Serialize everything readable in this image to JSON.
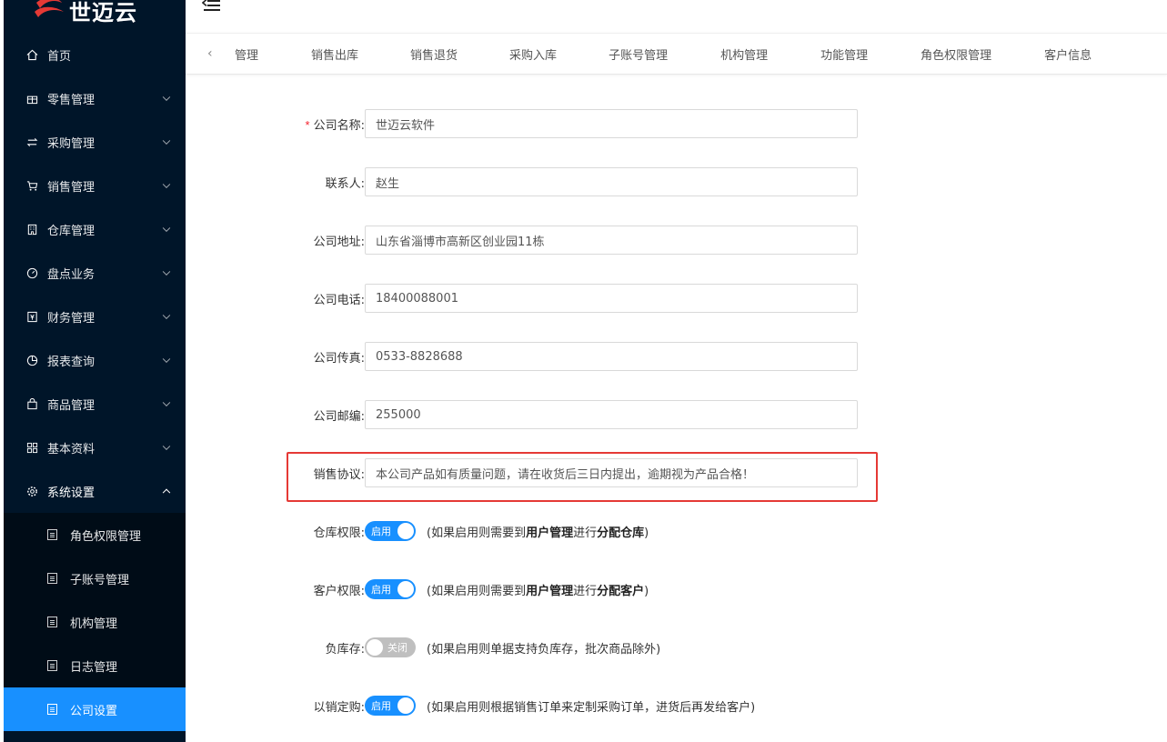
{
  "brand": {
    "name": "世迈云"
  },
  "sidebar": {
    "items": [
      {
        "label": "首页",
        "icon": "home-icon"
      },
      {
        "label": "零售管理",
        "icon": "gift-icon"
      },
      {
        "label": "采购管理",
        "icon": "swap-icon"
      },
      {
        "label": "销售管理",
        "icon": "cart-icon"
      },
      {
        "label": "仓库管理",
        "icon": "building-icon"
      },
      {
        "label": "盘点业务",
        "icon": "dashboard-icon"
      },
      {
        "label": "财务管理",
        "icon": "account-book-icon"
      },
      {
        "label": "报表查询",
        "icon": "pie-chart-icon"
      },
      {
        "label": "商品管理",
        "icon": "shopping-bag-icon"
      },
      {
        "label": "基本资料",
        "icon": "appstore-icon"
      },
      {
        "label": "系统设置",
        "icon": "setting-icon"
      }
    ],
    "submenu": [
      {
        "label": "角色权限管理"
      },
      {
        "label": "子账号管理"
      },
      {
        "label": "机构管理"
      },
      {
        "label": "日志管理"
      },
      {
        "label": "公司设置"
      }
    ]
  },
  "tabs": {
    "items": [
      "管理",
      "销售出库",
      "销售退货",
      "采购入库",
      "子账号管理",
      "机构管理",
      "功能管理",
      "角色权限管理",
      "客户信息"
    ]
  },
  "form": {
    "company_name": {
      "label": "公司名称:",
      "value": "世迈云软件",
      "required_mark": "*"
    },
    "contact": {
      "label": "联系人:",
      "value": "赵生"
    },
    "address": {
      "label": "公司地址:",
      "value": "山东省淄博市高新区创业园11栋"
    },
    "phone": {
      "label": "公司电话:",
      "value": "18400088001"
    },
    "fax": {
      "label": "公司传真:",
      "value": "0533-8828688"
    },
    "postcode": {
      "label": "公司邮编:",
      "value": "255000"
    },
    "agreement": {
      "label": "销售协议:",
      "value": "本公司产品如有质量问题，请在收货后三日内提出，逾期视为产品合格！"
    },
    "warehouse_perm": {
      "label": "仓库权限:",
      "switch": "启用",
      "hint_pre": "(如果启用则需要到",
      "hint_b1": "用户管理",
      "hint_mid": "进行",
      "hint_b2": "分配仓库",
      "hint_post": ")"
    },
    "customer_perm": {
      "label": "客户权限:",
      "switch": "启用",
      "hint_pre": "(如果启用则需要到",
      "hint_b1": "用户管理",
      "hint_mid": "进行",
      "hint_b2": "分配客户",
      "hint_post": ")"
    },
    "negative_stock": {
      "label": "负库存:",
      "switch": "关闭",
      "hint": "(如果启用则单据支持负库存，批次商品除外)"
    },
    "sales_to_purchase": {
      "label": "以销定购:",
      "switch": "启用",
      "hint": "(如果启用则根据销售订单来定制采购订单，进货后再发给客户)"
    }
  },
  "colors": {
    "sidebar_bg": "#001529",
    "active": "#1890ff",
    "highlight": "#e53935"
  }
}
